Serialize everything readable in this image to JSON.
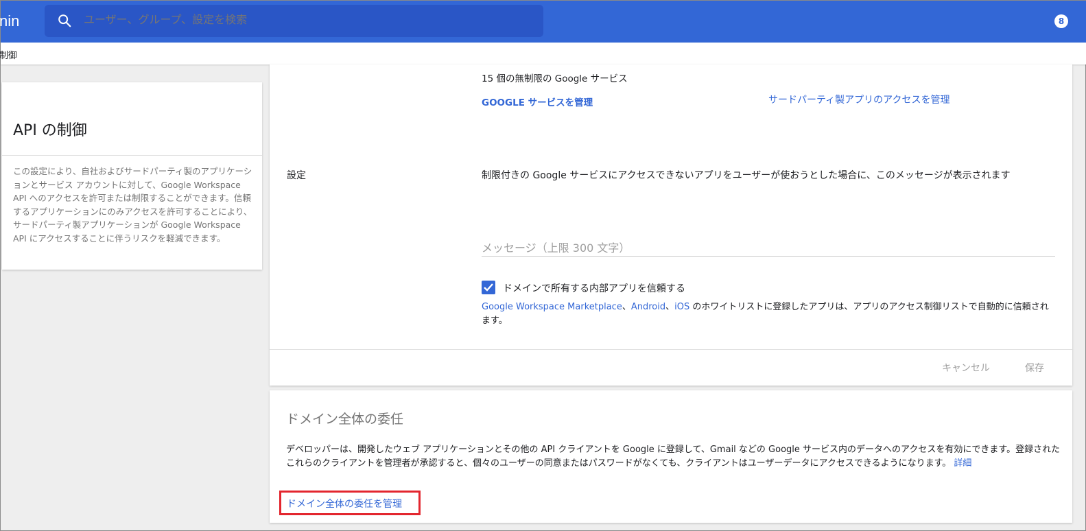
{
  "header": {
    "brand_fragment": "nin",
    "search_placeholder": "ユーザー、グループ、設定を検索",
    "account_badge": "8"
  },
  "breadcrumb": {
    "label": "制御"
  },
  "left_card": {
    "title": "API の制御",
    "description": "この設定により、自社およびサードパーティ製のアプリケーションとサービス アカウントに対して、Google Workspace API へのアクセスを許可または制限することができます。信頼するアプリケーションにのみアクセスを許可することにより、サードパーティ製アプリケーションが Google Workspace API にアクセスすることに伴うリスクを軽減できます。"
  },
  "settings_card": {
    "unlimited_text": "15 個の無制限の Google サービス",
    "manage_google_services": "GOOGLE サービスを管理",
    "manage_third_party": "サードパーティ製アプリのアクセスを管理",
    "setting_label": "設定",
    "setting_description": "制限付きの Google サービスにアクセスできないアプリをユーザーが使おうとした場合に、このメッセージが表示されます",
    "message_placeholder": "メッセージ（上限 300 文字）",
    "trust_internal_checked": true,
    "trust_internal_label": "ドメインで所有する内部アプリを信頼する",
    "note": {
      "link_marketplace": "Google Workspace Marketplace",
      "sep1": "、",
      "link_android": "Android",
      "sep2": "、",
      "link_ios": "iOS",
      "rest": " のホワイトリストに登録したアプリは、アプリのアクセス制御リストで自動的に信頼されます。"
    },
    "cancel_label": "キャンセル",
    "save_label": "保存"
  },
  "delegation_card": {
    "title": "ドメイン全体の委任",
    "description": "デベロッパーは、開発したウェブ アプリケーションとその他の API クライアントを Google に登録して、Gmail などの Google サービス内のデータへのアクセスを有効にできます。登録されたこれらのクライアントを管理者が承認すると、個々のユーザーの同意またはパスワードがなくても、クライアントはユーザーデータにアクセスできるようになります。",
    "details_link": "詳細",
    "manage_link": "ドメイン全体の委任を管理"
  },
  "colors": {
    "header_bg": "#3367d6",
    "link": "#3367d6",
    "highlight_border": "#e3262e"
  }
}
